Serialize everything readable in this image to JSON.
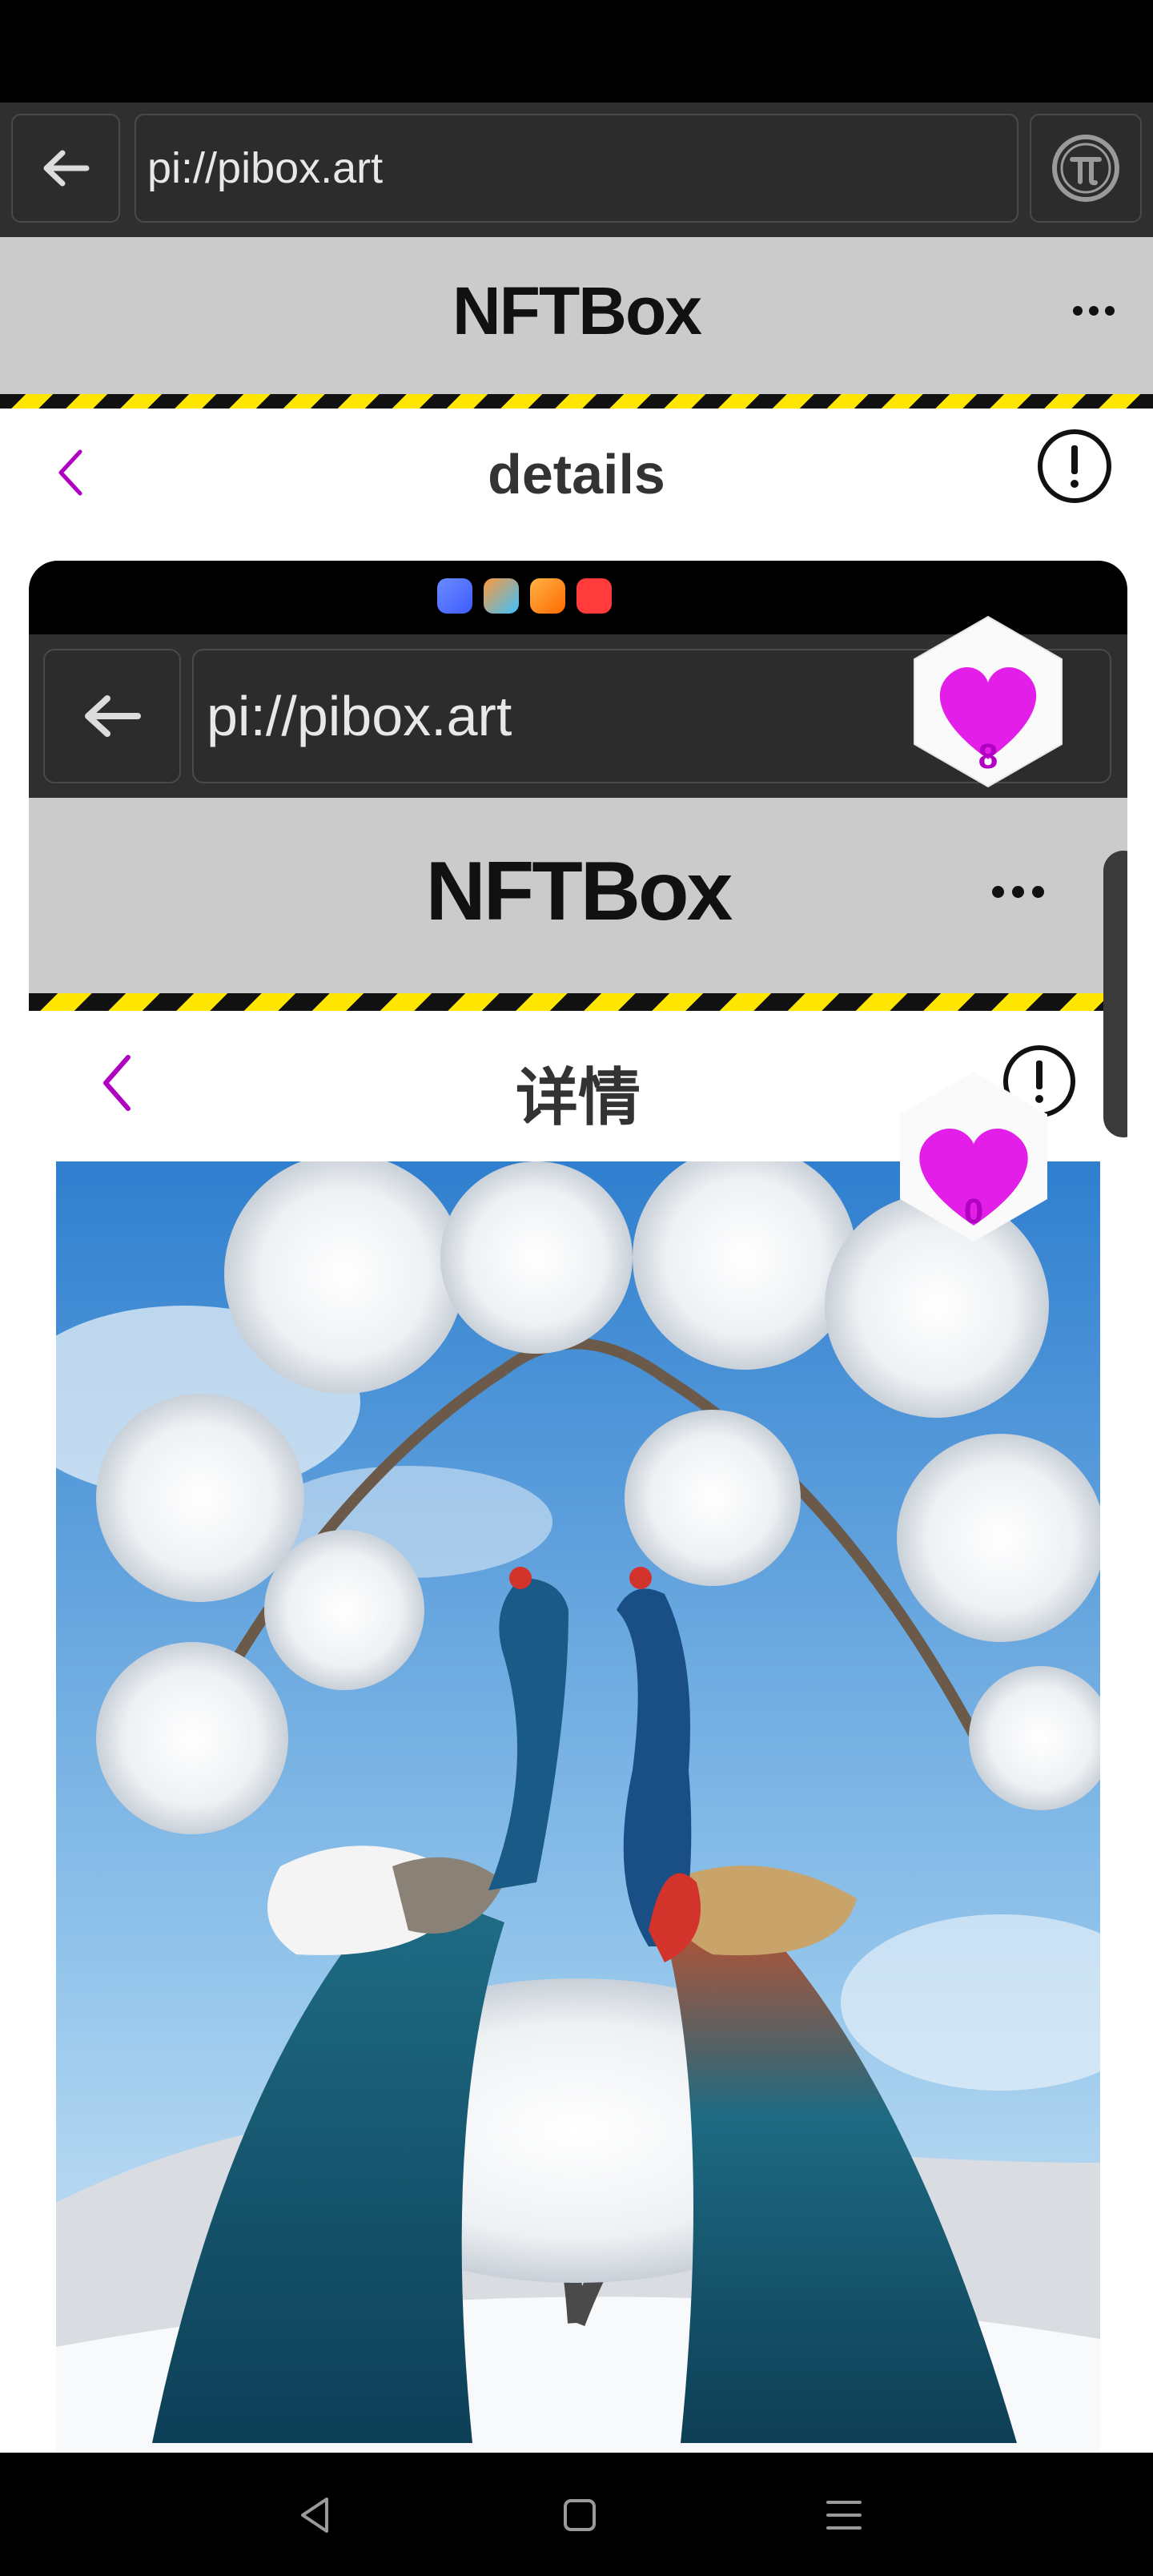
{
  "browser": {
    "url": "pi://pibox.art"
  },
  "app": {
    "title": "NFTBox"
  },
  "page": {
    "title": "details"
  },
  "inner": {
    "url": "pi://pibox.art",
    "app_title": "NFTBox",
    "page_title": "详情",
    "like_count": "0"
  },
  "likes": {
    "count": "8"
  },
  "colors": {
    "accent": "#b000c2",
    "heart": "#e21ee8",
    "hazard_yellow": "#ffe600",
    "header_gray": "#cbcbcb"
  },
  "icons": [
    "back-arrow-icon",
    "pi-logo-icon",
    "more-dots-icon",
    "chevron-left-icon",
    "info-icon",
    "heart-icon",
    "nav-back-icon",
    "nav-home-icon",
    "nav-menu-icon"
  ]
}
